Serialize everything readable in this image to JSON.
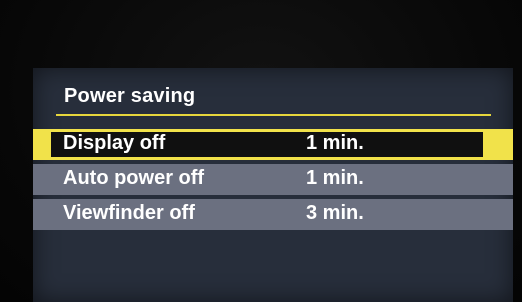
{
  "menu": {
    "title": "Power saving",
    "items": [
      {
        "label": "Display off",
        "value": "1 min.",
        "selected": true
      },
      {
        "label": "Auto power off",
        "value": "1 min.",
        "selected": false
      },
      {
        "label": "Viewfinder off",
        "value": "3 min.",
        "selected": false
      }
    ]
  },
  "colors": {
    "highlight": "#f1e24a",
    "row_background": "#6b7080",
    "panel_background": "#272e3b",
    "text": "#ffffff"
  }
}
